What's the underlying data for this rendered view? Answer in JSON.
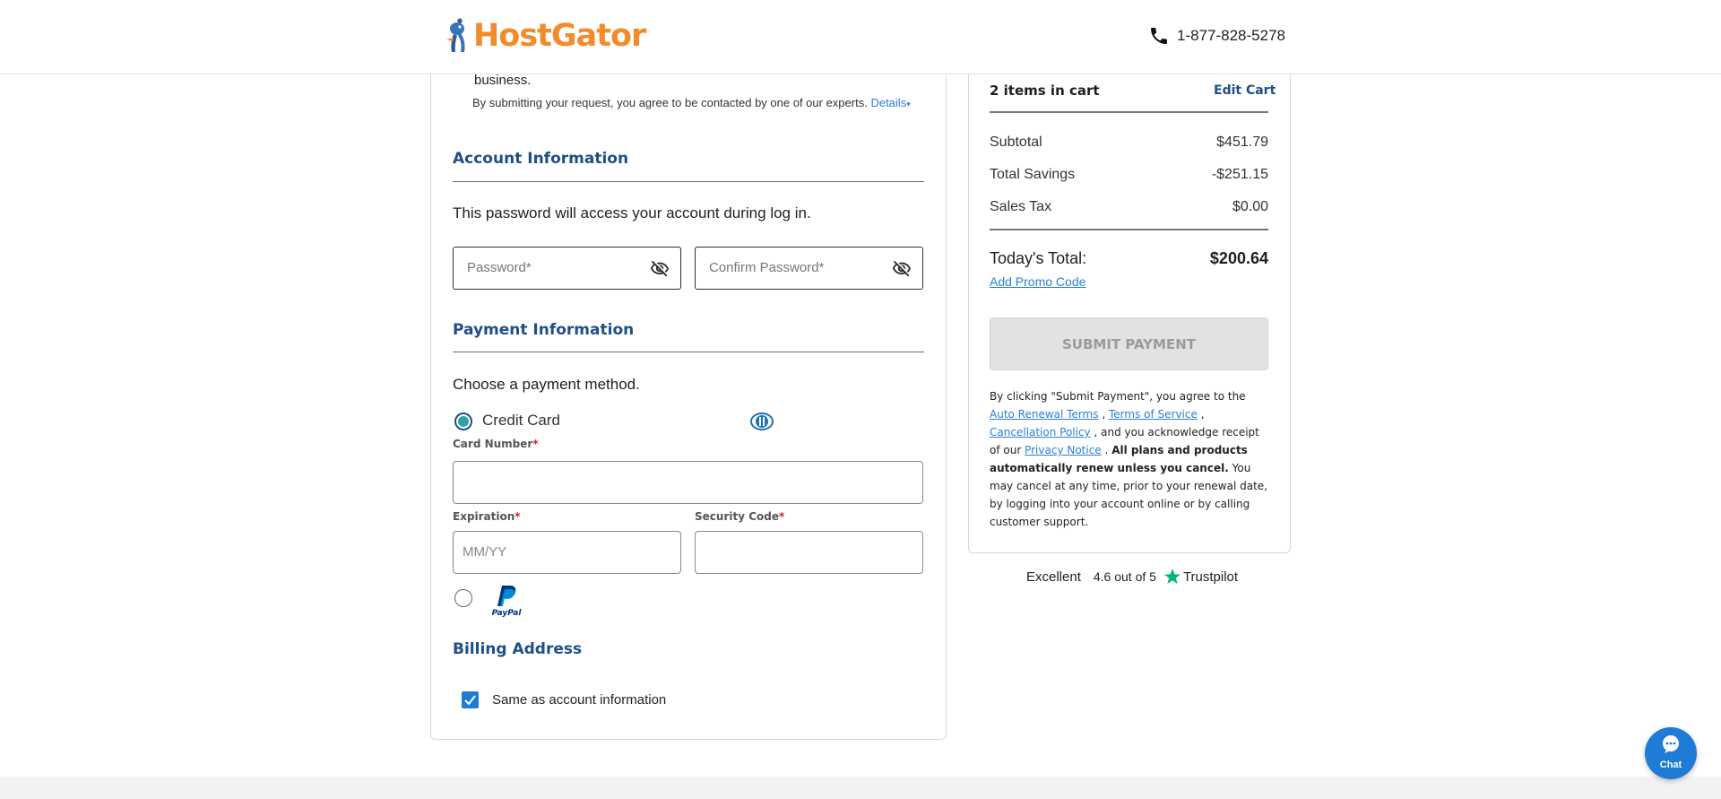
{
  "header": {
    "brand": "HostGator",
    "phone": "1-877-828-5278"
  },
  "intro": {
    "business_text": "business.",
    "consent_text": "By submitting your request, you agree to be contacted by one of our experts.",
    "details_link": "Details"
  },
  "account": {
    "title": "Account Information",
    "description": "This password will access your account during log in.",
    "password_placeholder": "Password*",
    "confirm_placeholder": "Confirm Password*"
  },
  "payment": {
    "title": "Payment Information",
    "choose_text": "Choose a payment method.",
    "credit_card_label": "Credit Card",
    "card_number_label": "Card Number",
    "expiration_label": "Expiration",
    "expiration_placeholder": "MM/YY",
    "security_code_label": "Security Code",
    "required_marker": "*",
    "paypal_label": "PayPal"
  },
  "billing": {
    "title": "Billing Address",
    "same_as_label": "Same as account information"
  },
  "cart": {
    "items_label": "2 items in cart",
    "edit_label": "Edit Cart",
    "subtotal_label": "Subtotal",
    "subtotal_value": "$451.79",
    "savings_label": "Total Savings",
    "savings_value": "-$251.15",
    "tax_label": "Sales Tax",
    "tax_value": "$0.00",
    "total_label": "Today's Total:",
    "total_value": "$200.64",
    "promo_label": "Add Promo Code",
    "submit_label": "SUBMIT PAYMENT"
  },
  "legal": {
    "p1": "By clicking \"Submit Payment\", you agree to the",
    "auto_renewal": "Auto Renewal Terms",
    "comma1": ",",
    "terms": "Terms of Service",
    "comma2": ",",
    "cancellation": "Cancellation Policy",
    "p2": ", and you acknowledge receipt of our",
    "privacy": "Privacy Notice",
    "p3": ".",
    "bold": "All plans and products automatically renew unless you cancel.",
    "p4": "You may cancel at any time, prior to your renewal date, by logging into your account online or by calling customer support."
  },
  "trustpilot": {
    "excellent": "Excellent",
    "rating": "4.6 out of 5",
    "brand": "Trustpilot"
  },
  "chat": {
    "label": "Chat"
  },
  "colors": {
    "brand_orange": "#f38b2a",
    "heading_blue": "#1f4f86",
    "link_blue": "#2a7fd4",
    "trustpilot_green": "#00b67a"
  }
}
